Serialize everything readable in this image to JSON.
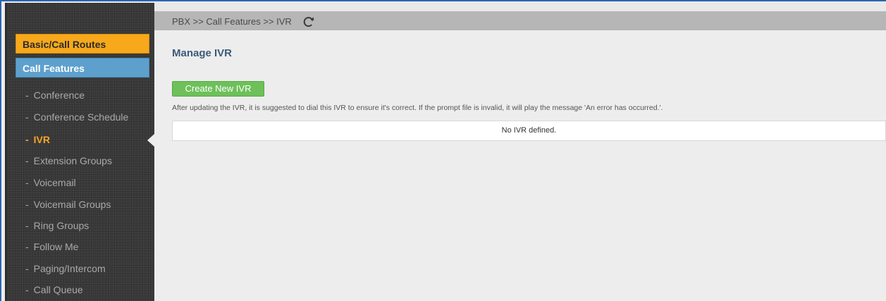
{
  "breadcrumb": {
    "text": "PBX >> Call Features >> IVR"
  },
  "sidebar": {
    "categories": [
      {
        "label": "Basic/Call Routes"
      },
      {
        "label": "Call Features"
      }
    ],
    "dash": "-",
    "items": [
      {
        "label": "Conference"
      },
      {
        "label": "Conference Schedule"
      },
      {
        "label": "IVR"
      },
      {
        "label": "Extension Groups"
      },
      {
        "label": "Voicemail"
      },
      {
        "label": "Voicemail Groups"
      },
      {
        "label": "Ring Groups"
      },
      {
        "label": "Follow Me"
      },
      {
        "label": "Paging/Intercom"
      },
      {
        "label": "Call Queue"
      }
    ],
    "active_item": "IVR"
  },
  "main": {
    "title": "Manage IVR",
    "create_button": "Create New IVR",
    "hint": "After updating the IVR, it is suggested to dial this IVR to ensure it's correct. If the prompt file is invalid, it will play the message 'An error has occurred.'.",
    "empty_message": "No IVR defined."
  },
  "colors": {
    "active_orange": "#f6a623",
    "category_orange": "#f7a81b",
    "category_blue": "#5ea0cd",
    "button_green": "#6dc05a",
    "title_blue": "#3d5a7a",
    "frame_blue": "#2d66b0"
  },
  "icons": {
    "refresh": "refresh-icon"
  }
}
